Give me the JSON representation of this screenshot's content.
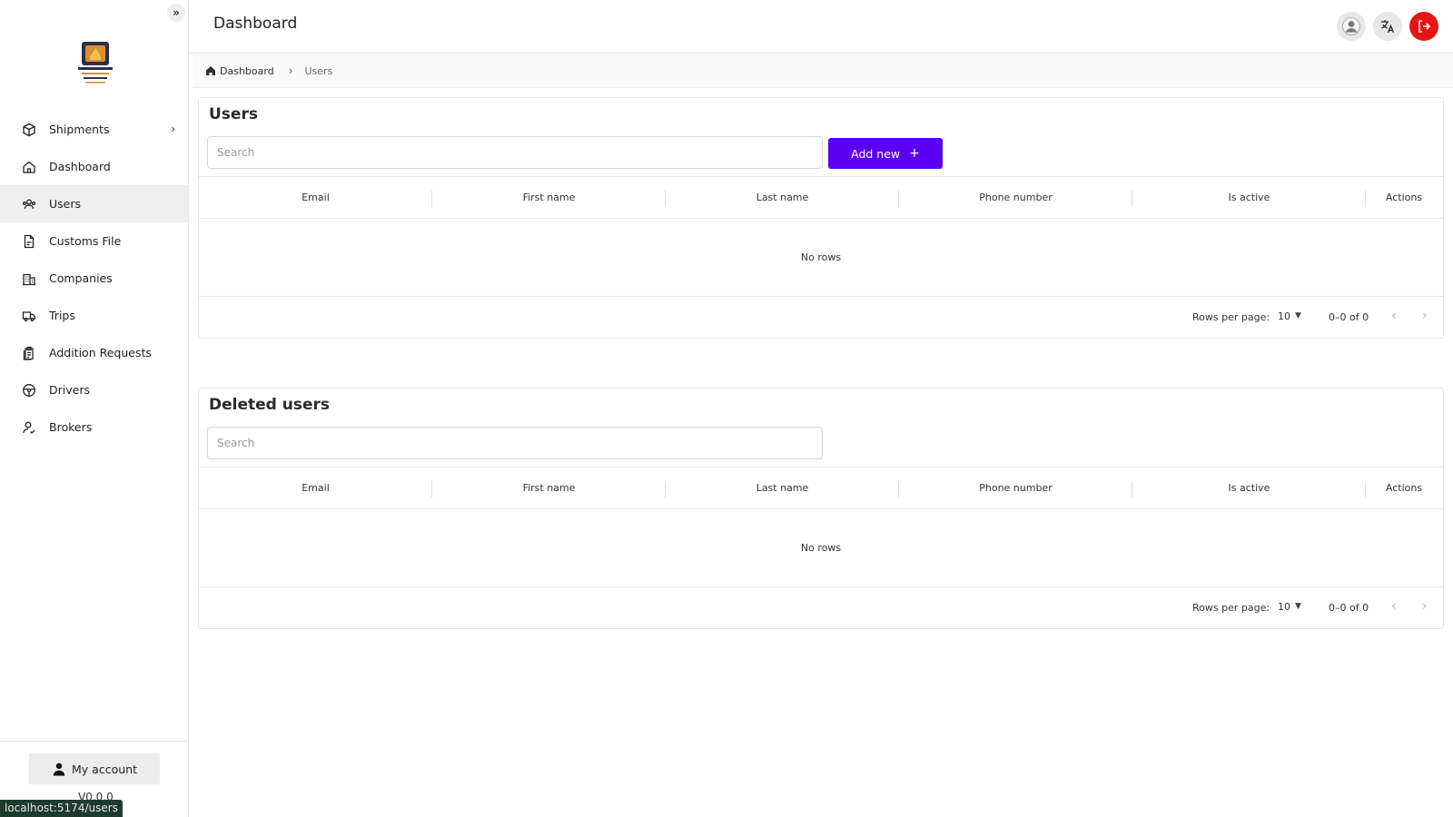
{
  "header": {
    "title": "Dashboard"
  },
  "sidebar": {
    "collapse_glyph": "»",
    "items": [
      {
        "label": "Shipments",
        "icon": "box-icon",
        "has_submenu": true
      },
      {
        "label": "Dashboard",
        "icon": "home-icon"
      },
      {
        "label": "Users",
        "icon": "users-icon",
        "active": true
      },
      {
        "label": "Customs File",
        "icon": "file-icon"
      },
      {
        "label": "Companies",
        "icon": "building-icon"
      },
      {
        "label": "Trips",
        "icon": "truck-icon"
      },
      {
        "label": "Addition Requests",
        "icon": "clipboard-icon"
      },
      {
        "label": "Drivers",
        "icon": "steering-wheel-icon"
      },
      {
        "label": "Brokers",
        "icon": "user-check-icon"
      }
    ],
    "account_label": "My account",
    "version": "V0.0.0"
  },
  "status_bar": {
    "url": "localhost:5174/users"
  },
  "breadcrumb": {
    "home": "Dashboard",
    "current": "Users"
  },
  "users_card": {
    "title": "Users",
    "search_placeholder": "Search",
    "add_label": "Add new",
    "add_glyph": "+",
    "columns": [
      "Email",
      "First name",
      "Last name",
      "Phone number",
      "Is active",
      "Actions"
    ],
    "empty_text": "No rows",
    "rows_per_page_label": "Rows per page:",
    "rows_per_page": "10",
    "range": "0–0 of 0"
  },
  "deleted_card": {
    "title": "Deleted users",
    "search_placeholder": "Search",
    "columns": [
      "Email",
      "First name",
      "Last name",
      "Phone number",
      "Is active",
      "Actions"
    ],
    "empty_text": "No rows",
    "rows_per_page_label": "Rows per page:",
    "rows_per_page": "10",
    "range": "0–0 of 0"
  },
  "colors": {
    "primary": "#5c00f2",
    "logout": "#e81414",
    "active_nav": "#efefef"
  }
}
